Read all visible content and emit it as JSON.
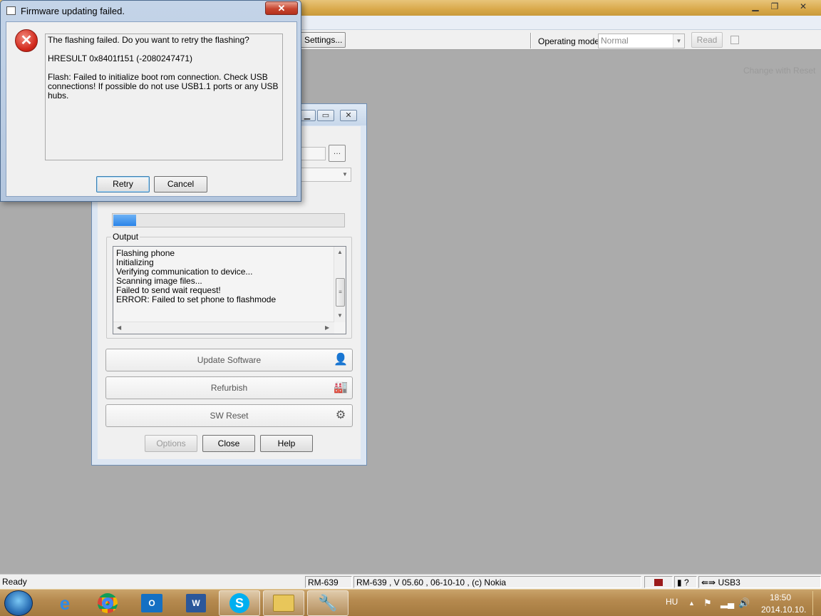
{
  "main_window": {
    "toolbar": {
      "settings_label": "Settings...",
      "operating_mode_label": "Operating mode:",
      "operating_mode_value": "Normal",
      "read_label": "Read",
      "change_with_reset_label": "Change with Reset"
    },
    "statusbar": {
      "ready": "Ready",
      "model": "RM-639",
      "version_info": "RM-639 , V 05.60 , 06-10-10 , (c) Nokia",
      "connection": "USB3"
    }
  },
  "inner_window": {
    "progress_fraction": 0.1,
    "output": {
      "label": "Output",
      "lines": [
        "Flashing phone",
        "Initializing",
        "Verifying communication to device...",
        "Scanning image files...",
        "Failed to send wait request!",
        "ERROR: Failed to set phone to flashmode"
      ]
    },
    "buttons": {
      "update_software": "Update Software",
      "refurbish": "Refurbish",
      "sw_reset": "SW Reset",
      "options": "Options",
      "close": "Close",
      "help": "Help"
    }
  },
  "dialog": {
    "title": "Firmware updating failed.",
    "message_question": "The flashing failed. Do you want to retry the flashing?",
    "message_hresult": "HRESULT 0x8401f151 (-2080247471)",
    "message_detail": "Flash: Failed to initialize boot rom connection. Check USB connections! If possible do not use USB1.1 ports or any USB hubs.",
    "retry_label": "Retry",
    "cancel_label": "Cancel"
  },
  "taskbar": {
    "language": "HU",
    "time": "18:50",
    "date": "2014.10.10.",
    "apps": [
      "internet-explorer",
      "chrome",
      "outlook",
      "word",
      "skype",
      "file-explorer",
      "phoenix-tool"
    ]
  }
}
